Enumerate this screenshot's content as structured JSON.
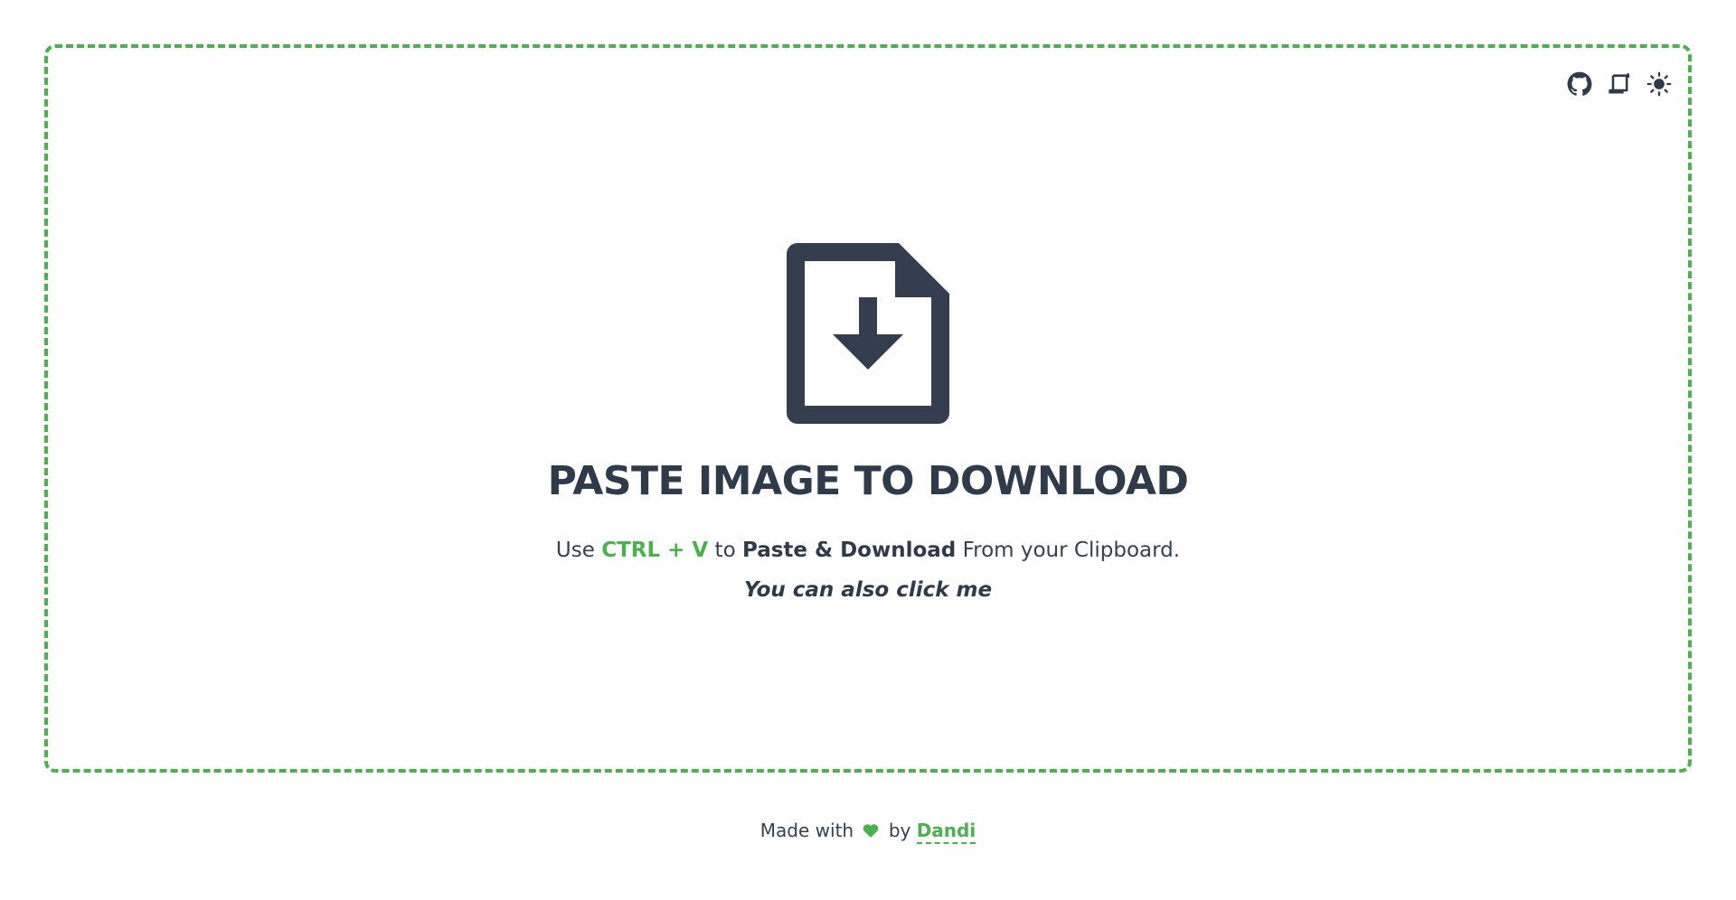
{
  "dropzone": {
    "title": "PASTE IMAGE TO DOWNLOAD",
    "desc_prefix": "Use",
    "shortcut": "CTRL + V",
    "desc_mid": "to",
    "action": "Paste & Download",
    "desc_suffix": "From your Clipboard.",
    "hint": "You can also click me"
  },
  "top_icons": [
    "github-icon",
    "scroll-icon",
    "sun-icon"
  ],
  "footer": {
    "prefix": "Made with",
    "by": "by",
    "author": "Dandi"
  },
  "colors": {
    "accent": "#48b34a",
    "text": "#334155",
    "icon": "#343e4f"
  }
}
